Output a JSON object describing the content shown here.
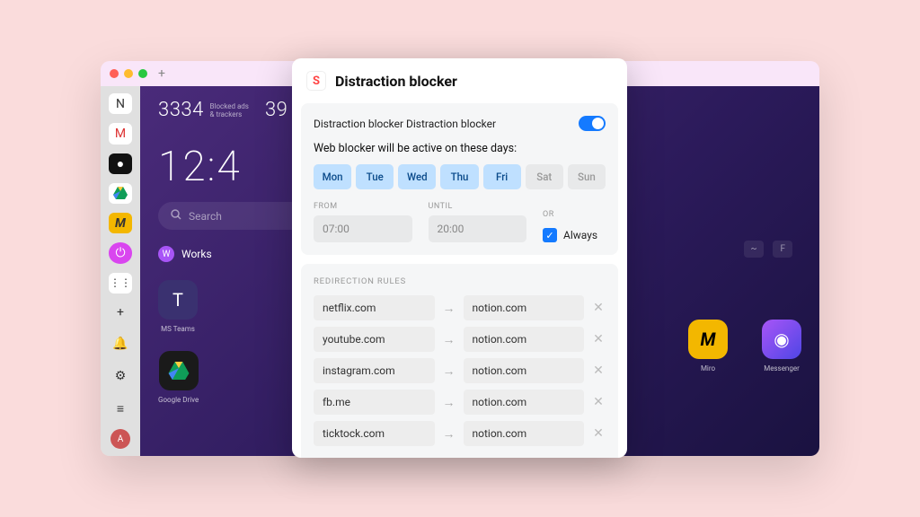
{
  "window": {
    "stats": {
      "count": "3334",
      "label": "Blocked ads\n& trackers",
      "pct": "39"
    },
    "clock": "12:4",
    "search_placeholder": "Search",
    "search_opts": [
      "~",
      "F"
    ],
    "workspace": {
      "badge": "W",
      "label": "Works"
    },
    "apps_left": [
      {
        "name": "MS Teams",
        "bg": "#3a3170",
        "glyph": "T"
      },
      {
        "name": "Google Drive",
        "bg": "#1a1a1a",
        "glyph": "△"
      }
    ],
    "apps_right": [
      {
        "name": "Miro",
        "bg": "#f3b700",
        "glyph": "M"
      },
      {
        "name": "Messenger",
        "bg": "#5b2bd9",
        "glyph": "◉"
      }
    ]
  },
  "sidebar": {
    "top": [
      "N",
      "M",
      "●",
      "▲",
      "M",
      "◎",
      "⋮⋮",
      "+"
    ],
    "bottom": [
      "🔔",
      "⚙",
      "≡"
    ],
    "avatar": "A"
  },
  "popup": {
    "title": "Distraction blocker",
    "toggle_label": "Distraction blocker Distraction blocker",
    "toggle_on": true,
    "desc": "Web blocker will be active on these days:",
    "days": [
      {
        "label": "Mon",
        "on": true
      },
      {
        "label": "Tue",
        "on": true
      },
      {
        "label": "Wed",
        "on": true
      },
      {
        "label": "Thu",
        "on": true
      },
      {
        "label": "Fri",
        "on": true
      },
      {
        "label": "Sat",
        "on": false
      },
      {
        "label": "Sun",
        "on": false
      }
    ],
    "from_label": "From",
    "from": "07:00",
    "until_label": "Until",
    "until": "20:00",
    "or_label": "Or",
    "always_label": "Always",
    "always_checked": true,
    "rules_title": "Redirection rules",
    "rules": [
      {
        "from": "netflix.com",
        "to": "notion.com"
      },
      {
        "from": "youtube.com",
        "to": "notion.com"
      },
      {
        "from": "instagram.com",
        "to": "notion.com"
      },
      {
        "from": "fb.me",
        "to": "notion.com"
      },
      {
        "from": "ticktock.com",
        "to": "notion.com"
      }
    ]
  }
}
